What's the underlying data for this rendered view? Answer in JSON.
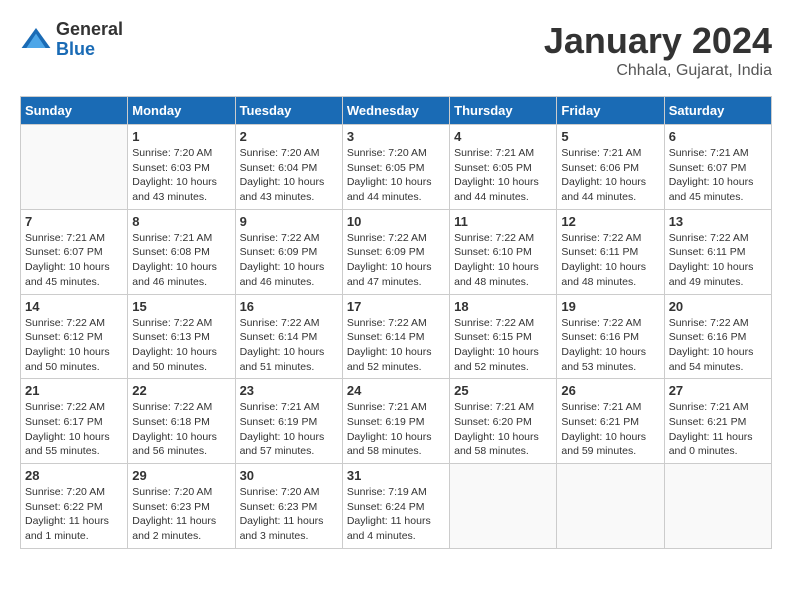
{
  "header": {
    "logo": {
      "general": "General",
      "blue": "Blue"
    },
    "title": "January 2024",
    "subtitle": "Chhala, Gujarat, India"
  },
  "days_of_week": [
    "Sunday",
    "Monday",
    "Tuesday",
    "Wednesday",
    "Thursday",
    "Friday",
    "Saturday"
  ],
  "weeks": [
    [
      {
        "day": "",
        "sunrise": "",
        "sunset": "",
        "daylight": ""
      },
      {
        "day": "1",
        "sunrise": "Sunrise: 7:20 AM",
        "sunset": "Sunset: 6:03 PM",
        "daylight": "Daylight: 10 hours and 43 minutes."
      },
      {
        "day": "2",
        "sunrise": "Sunrise: 7:20 AM",
        "sunset": "Sunset: 6:04 PM",
        "daylight": "Daylight: 10 hours and 43 minutes."
      },
      {
        "day": "3",
        "sunrise": "Sunrise: 7:20 AM",
        "sunset": "Sunset: 6:05 PM",
        "daylight": "Daylight: 10 hours and 44 minutes."
      },
      {
        "day": "4",
        "sunrise": "Sunrise: 7:21 AM",
        "sunset": "Sunset: 6:05 PM",
        "daylight": "Daylight: 10 hours and 44 minutes."
      },
      {
        "day": "5",
        "sunrise": "Sunrise: 7:21 AM",
        "sunset": "Sunset: 6:06 PM",
        "daylight": "Daylight: 10 hours and 44 minutes."
      },
      {
        "day": "6",
        "sunrise": "Sunrise: 7:21 AM",
        "sunset": "Sunset: 6:07 PM",
        "daylight": "Daylight: 10 hours and 45 minutes."
      }
    ],
    [
      {
        "day": "7",
        "sunrise": "Sunrise: 7:21 AM",
        "sunset": "Sunset: 6:07 PM",
        "daylight": "Daylight: 10 hours and 45 minutes."
      },
      {
        "day": "8",
        "sunrise": "Sunrise: 7:21 AM",
        "sunset": "Sunset: 6:08 PM",
        "daylight": "Daylight: 10 hours and 46 minutes."
      },
      {
        "day": "9",
        "sunrise": "Sunrise: 7:22 AM",
        "sunset": "Sunset: 6:09 PM",
        "daylight": "Daylight: 10 hours and 46 minutes."
      },
      {
        "day": "10",
        "sunrise": "Sunrise: 7:22 AM",
        "sunset": "Sunset: 6:09 PM",
        "daylight": "Daylight: 10 hours and 47 minutes."
      },
      {
        "day": "11",
        "sunrise": "Sunrise: 7:22 AM",
        "sunset": "Sunset: 6:10 PM",
        "daylight": "Daylight: 10 hours and 48 minutes."
      },
      {
        "day": "12",
        "sunrise": "Sunrise: 7:22 AM",
        "sunset": "Sunset: 6:11 PM",
        "daylight": "Daylight: 10 hours and 48 minutes."
      },
      {
        "day": "13",
        "sunrise": "Sunrise: 7:22 AM",
        "sunset": "Sunset: 6:11 PM",
        "daylight": "Daylight: 10 hours and 49 minutes."
      }
    ],
    [
      {
        "day": "14",
        "sunrise": "Sunrise: 7:22 AM",
        "sunset": "Sunset: 6:12 PM",
        "daylight": "Daylight: 10 hours and 50 minutes."
      },
      {
        "day": "15",
        "sunrise": "Sunrise: 7:22 AM",
        "sunset": "Sunset: 6:13 PM",
        "daylight": "Daylight: 10 hours and 50 minutes."
      },
      {
        "day": "16",
        "sunrise": "Sunrise: 7:22 AM",
        "sunset": "Sunset: 6:14 PM",
        "daylight": "Daylight: 10 hours and 51 minutes."
      },
      {
        "day": "17",
        "sunrise": "Sunrise: 7:22 AM",
        "sunset": "Sunset: 6:14 PM",
        "daylight": "Daylight: 10 hours and 52 minutes."
      },
      {
        "day": "18",
        "sunrise": "Sunrise: 7:22 AM",
        "sunset": "Sunset: 6:15 PM",
        "daylight": "Daylight: 10 hours and 52 minutes."
      },
      {
        "day": "19",
        "sunrise": "Sunrise: 7:22 AM",
        "sunset": "Sunset: 6:16 PM",
        "daylight": "Daylight: 10 hours and 53 minutes."
      },
      {
        "day": "20",
        "sunrise": "Sunrise: 7:22 AM",
        "sunset": "Sunset: 6:16 PM",
        "daylight": "Daylight: 10 hours and 54 minutes."
      }
    ],
    [
      {
        "day": "21",
        "sunrise": "Sunrise: 7:22 AM",
        "sunset": "Sunset: 6:17 PM",
        "daylight": "Daylight: 10 hours and 55 minutes."
      },
      {
        "day": "22",
        "sunrise": "Sunrise: 7:22 AM",
        "sunset": "Sunset: 6:18 PM",
        "daylight": "Daylight: 10 hours and 56 minutes."
      },
      {
        "day": "23",
        "sunrise": "Sunrise: 7:21 AM",
        "sunset": "Sunset: 6:19 PM",
        "daylight": "Daylight: 10 hours and 57 minutes."
      },
      {
        "day": "24",
        "sunrise": "Sunrise: 7:21 AM",
        "sunset": "Sunset: 6:19 PM",
        "daylight": "Daylight: 10 hours and 58 minutes."
      },
      {
        "day": "25",
        "sunrise": "Sunrise: 7:21 AM",
        "sunset": "Sunset: 6:20 PM",
        "daylight": "Daylight: 10 hours and 58 minutes."
      },
      {
        "day": "26",
        "sunrise": "Sunrise: 7:21 AM",
        "sunset": "Sunset: 6:21 PM",
        "daylight": "Daylight: 10 hours and 59 minutes."
      },
      {
        "day": "27",
        "sunrise": "Sunrise: 7:21 AM",
        "sunset": "Sunset: 6:21 PM",
        "daylight": "Daylight: 11 hours and 0 minutes."
      }
    ],
    [
      {
        "day": "28",
        "sunrise": "Sunrise: 7:20 AM",
        "sunset": "Sunset: 6:22 PM",
        "daylight": "Daylight: 11 hours and 1 minute."
      },
      {
        "day": "29",
        "sunrise": "Sunrise: 7:20 AM",
        "sunset": "Sunset: 6:23 PM",
        "daylight": "Daylight: 11 hours and 2 minutes."
      },
      {
        "day": "30",
        "sunrise": "Sunrise: 7:20 AM",
        "sunset": "Sunset: 6:23 PM",
        "daylight": "Daylight: 11 hours and 3 minutes."
      },
      {
        "day": "31",
        "sunrise": "Sunrise: 7:19 AM",
        "sunset": "Sunset: 6:24 PM",
        "daylight": "Daylight: 11 hours and 4 minutes."
      },
      {
        "day": "",
        "sunrise": "",
        "sunset": "",
        "daylight": ""
      },
      {
        "day": "",
        "sunrise": "",
        "sunset": "",
        "daylight": ""
      },
      {
        "day": "",
        "sunrise": "",
        "sunset": "",
        "daylight": ""
      }
    ]
  ]
}
